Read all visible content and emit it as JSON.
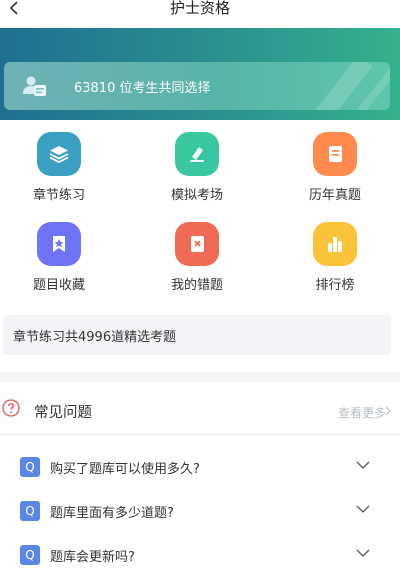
{
  "header": {
    "title": "护士资格"
  },
  "banner": {
    "text": "63810 位考生共同选择"
  },
  "grid": [
    {
      "label": "章节练习",
      "icon": "layers-icon",
      "color": "#3aa0c1"
    },
    {
      "label": "模拟考场",
      "icon": "pen-icon",
      "color": "#39c7a1"
    },
    {
      "label": "历年真题",
      "icon": "book-icon",
      "color": "#ff8a4d"
    },
    {
      "label": "题目收藏",
      "icon": "star-bookmark-icon",
      "color": "#6e74f3"
    },
    {
      "label": "我的错题",
      "icon": "wrong-book-icon",
      "color": "#f06a55"
    },
    {
      "label": "排行榜",
      "icon": "bar-chart-icon",
      "color": "#fbc33a"
    }
  ],
  "info": {
    "text": "章节练习共4996道精选考题"
  },
  "faq": {
    "title": "常见问题",
    "more": "查看更多",
    "badge": "Q",
    "items": [
      {
        "question": "购买了题库可以使用多久?"
      },
      {
        "question": "题库里面有多少道题?"
      },
      {
        "question": "题库会更新吗?"
      }
    ]
  }
}
